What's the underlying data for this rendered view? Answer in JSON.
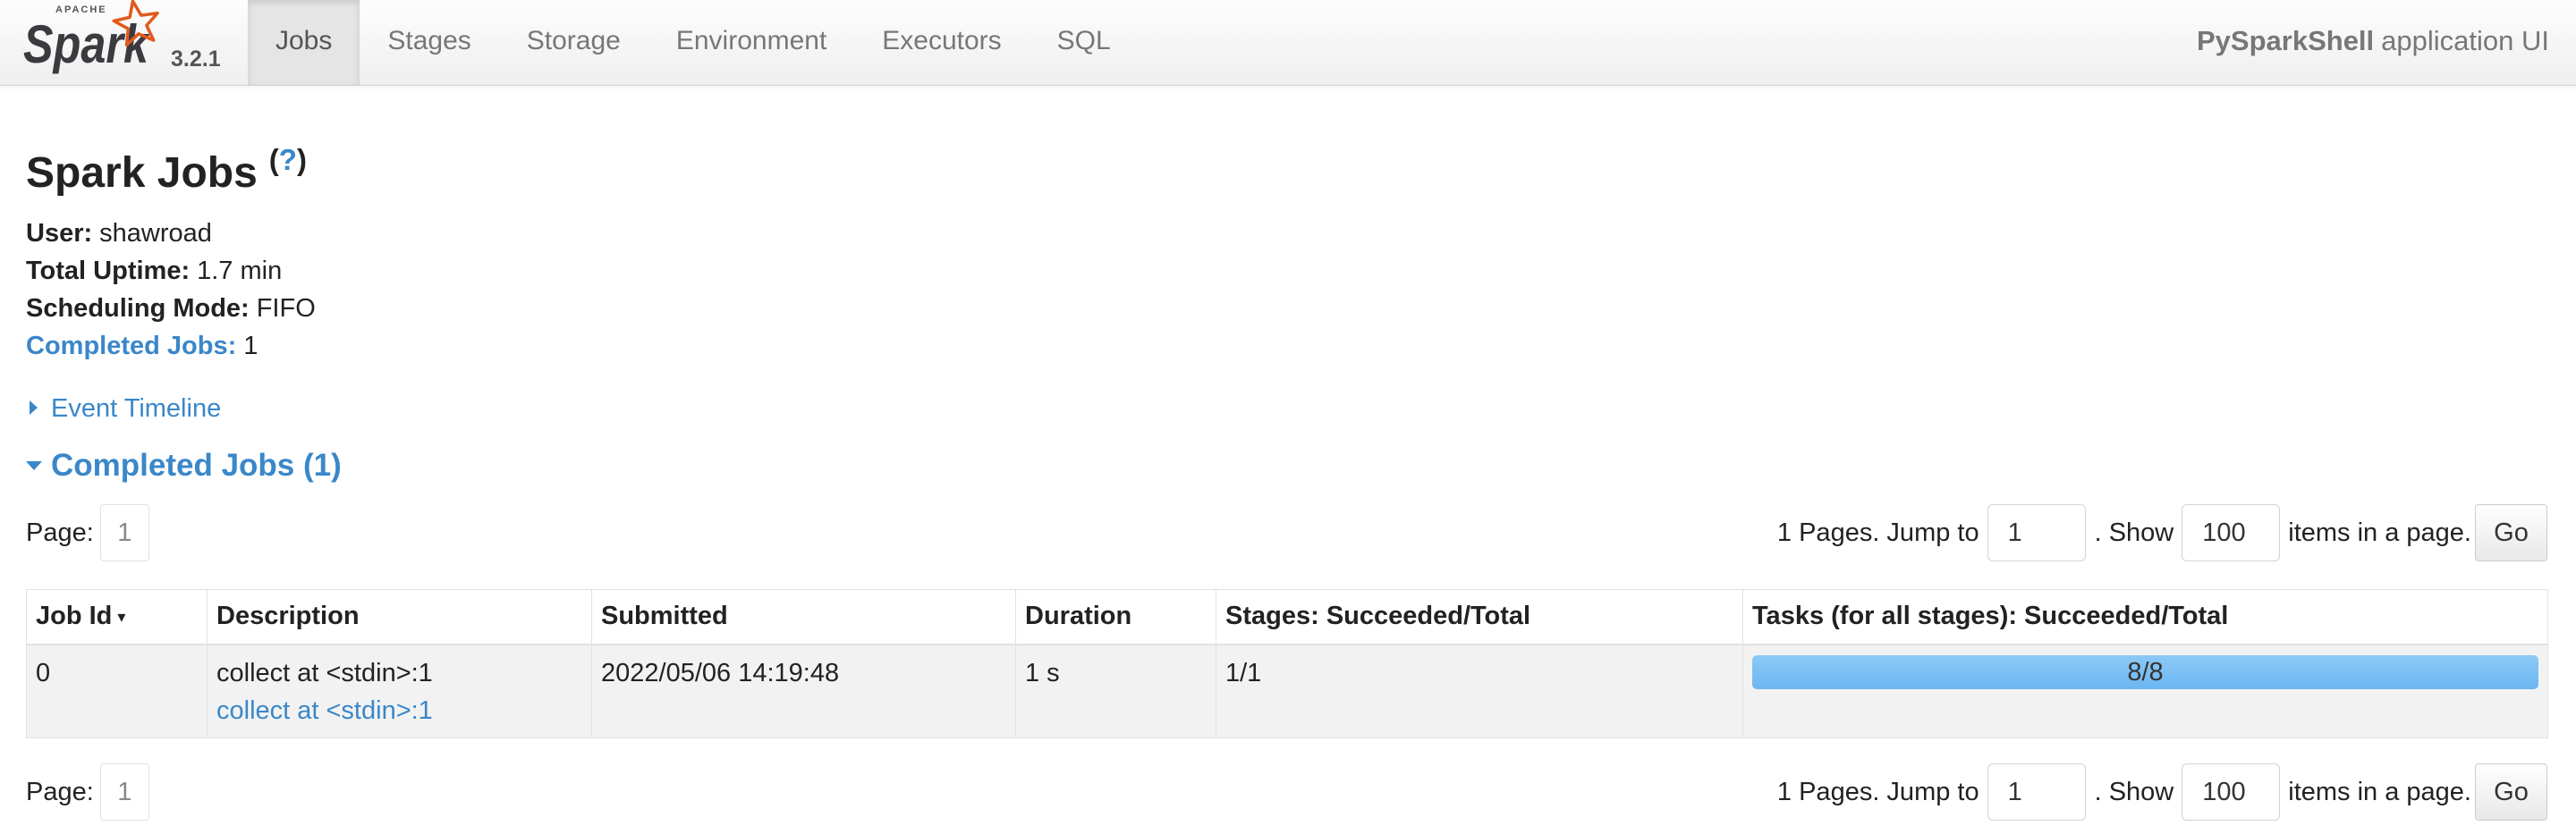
{
  "theme": {
    "link_color": "#3a87c9",
    "logo_star_color": "#e25a1c",
    "progress_color": "#6bb6f2"
  },
  "navbar": {
    "logo": {
      "apache": "APACHE",
      "spark": "Spark",
      "icon": "star-icon"
    },
    "version": "3.2.1",
    "tabs": [
      {
        "label": "Jobs",
        "active": true
      },
      {
        "label": "Stages",
        "active": false
      },
      {
        "label": "Storage",
        "active": false
      },
      {
        "label": "Environment",
        "active": false
      },
      {
        "label": "Executors",
        "active": false
      },
      {
        "label": "SQL",
        "active": false
      }
    ],
    "app_name": "PySparkShell",
    "app_suffix": "application UI"
  },
  "header": {
    "title": "Spark Jobs",
    "help": {
      "open": "(",
      "mark": "?",
      "close": ")"
    }
  },
  "summary": [
    {
      "label": "User:",
      "value": "shawroad"
    },
    {
      "label": "Total Uptime:",
      "value": "1.7 min"
    },
    {
      "label": "Scheduling Mode:",
      "value": "FIFO"
    },
    {
      "label": "Completed Jobs:",
      "value": "1"
    }
  ],
  "event_timeline": {
    "label": "Event Timeline",
    "expanded": false,
    "icon": "arrow-right-icon"
  },
  "completed_jobs": {
    "heading": "Completed Jobs (1)",
    "expanded": true,
    "icon": "arrow-down-icon",
    "pagination": {
      "page_label": "Page:",
      "current_page": "1",
      "pages_text": "1 Pages. Jump to",
      "jump_value": "1",
      "show_text": ". Show",
      "page_size": "100",
      "items_text": "items in a page.",
      "go_label": "Go"
    },
    "table": {
      "headers": [
        "Job Id",
        "Description",
        "Submitted",
        "Duration",
        "Stages: Succeeded/Total",
        "Tasks (for all stages): Succeeded/Total"
      ],
      "sort_indicator": "▾",
      "rows": [
        {
          "job_id": "0",
          "description": "collect at <stdin>:1",
          "description_link": "collect at <stdin>:1",
          "submitted": "2022/05/06 14:19:48",
          "duration": "1 s",
          "stages": "1/1",
          "tasks_label": "8/8",
          "tasks_succeeded": 8,
          "tasks_total": 8
        }
      ]
    }
  }
}
